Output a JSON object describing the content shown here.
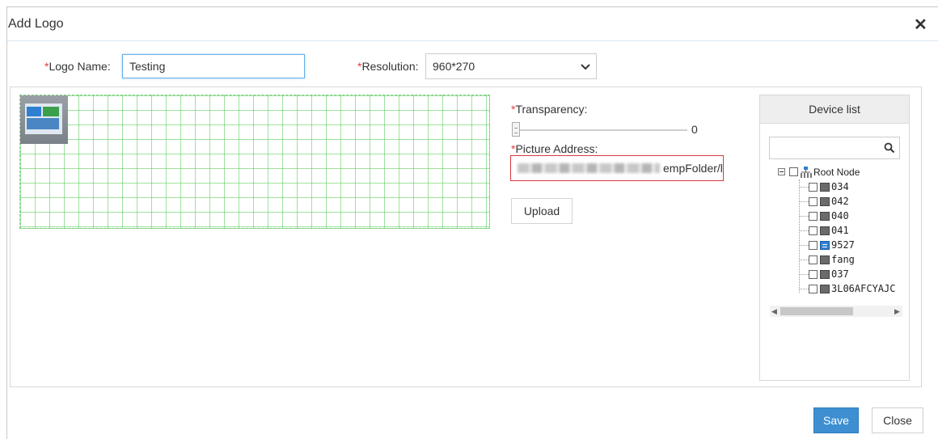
{
  "dialog": {
    "title": "Add Logo",
    "close_icon": "close-icon"
  },
  "form": {
    "required_mark": "*",
    "logo_name_label": "Logo Name:",
    "logo_name_value": "Testing",
    "resolution_label": "Resolution:",
    "resolution_value": "960*270",
    "transparency_label": "Transparency:",
    "transparency_value": "0",
    "picture_address_label": "Picture Address:",
    "picture_address_visible": "empFolder/l",
    "upload_label": "Upload"
  },
  "device_list": {
    "title": "Device list",
    "search_placeholder": "",
    "search_icon": "search-icon",
    "root": {
      "label": "Root Node",
      "expand_icon": "collapse-icon",
      "icon": "root-node-icon"
    },
    "devices": [
      {
        "label": "034",
        "icon": "device-icon"
      },
      {
        "label": "042",
        "icon": "device-icon"
      },
      {
        "label": "040",
        "icon": "device-icon"
      },
      {
        "label": "041",
        "icon": "device-icon"
      },
      {
        "label": "9527",
        "icon": "device-icon-blue"
      },
      {
        "label": "fang",
        "icon": "device-icon"
      },
      {
        "label": "037",
        "icon": "device-icon"
      },
      {
        "label": "3L06AFCYAJC",
        "icon": "device-icon"
      }
    ]
  },
  "footer": {
    "save_label": "Save",
    "close_label": "Close"
  },
  "colors": {
    "accent": "#3d8fd1",
    "required": "#e03c3c",
    "error_border": "#d9393e",
    "grid": "#7ccf7c"
  }
}
